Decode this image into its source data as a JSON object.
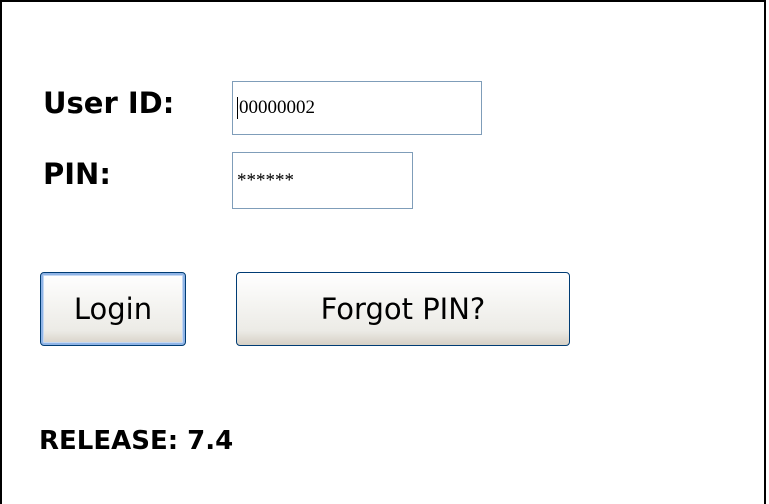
{
  "form": {
    "userid_label": "User ID:",
    "userid_value": "00000002",
    "pin_label": "PIN:",
    "pin_value": "******"
  },
  "buttons": {
    "login_label": "Login",
    "forgot_pin_label": "Forgot PIN?"
  },
  "footer": {
    "release_text": "RELEASE: 7.4"
  }
}
